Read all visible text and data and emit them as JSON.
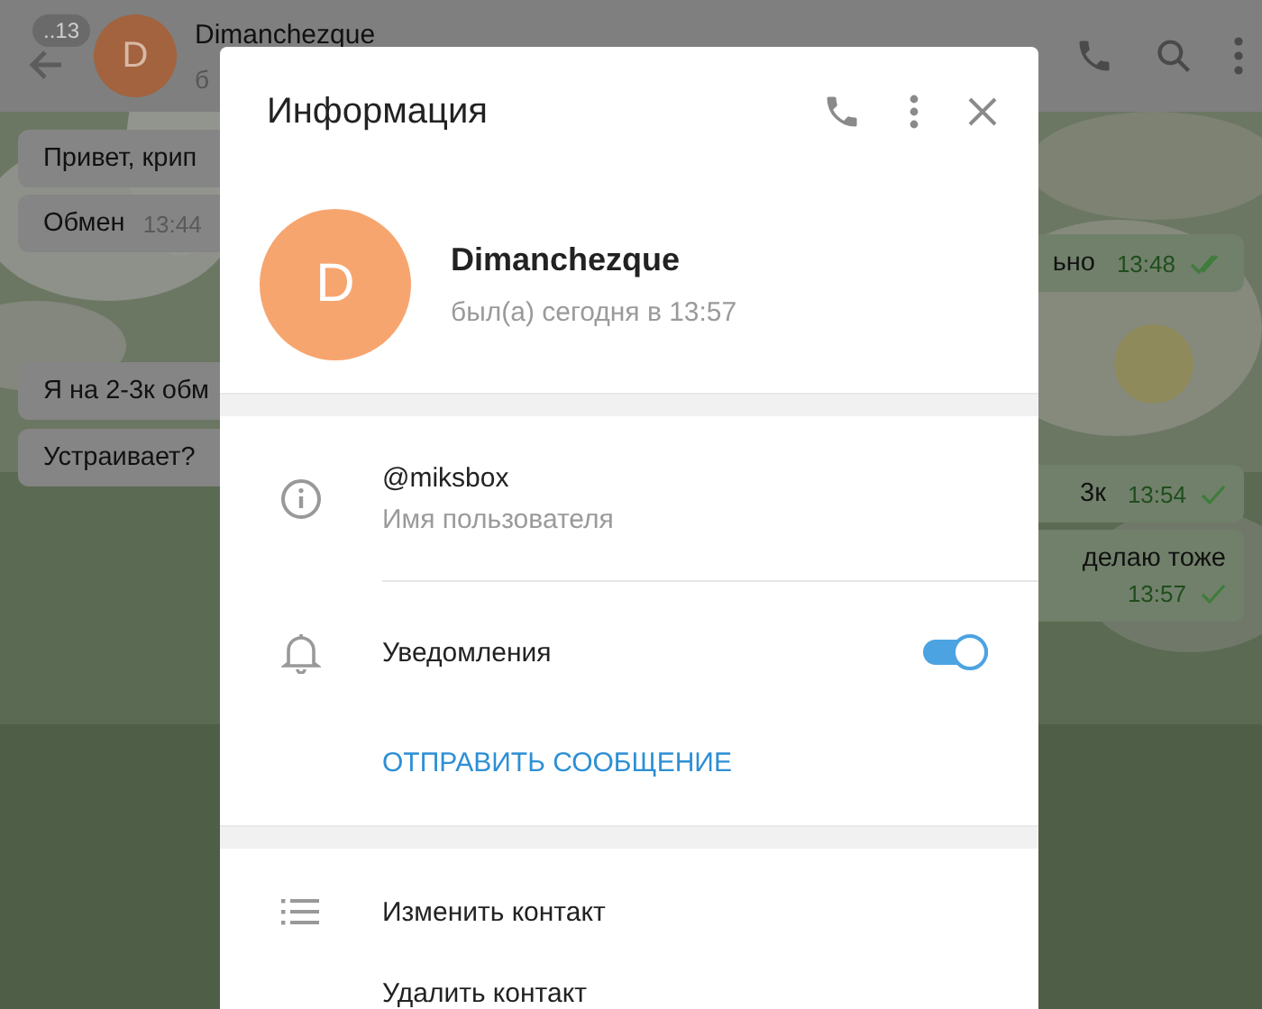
{
  "chat_header": {
    "badge": "..13",
    "avatar_letter": "D",
    "name": "Dimanchezque",
    "status": "б"
  },
  "messages_left": [
    {
      "text": "Привет, крип"
    },
    {
      "text": "Обмен",
      "time": "13:44"
    },
    {
      "text": "Я на 2-3к обм"
    },
    {
      "text": "Устраивает?"
    }
  ],
  "messages_right": [
    {
      "text": "ьно",
      "time": "13:48",
      "read": true
    },
    {
      "text": "3к",
      "time": "13:54",
      "read": false
    },
    {
      "text": "делаю тоже",
      "time": "13:57",
      "read": false
    }
  ],
  "dialog": {
    "title": "Информация",
    "avatar_letter": "D",
    "name": "Dimanchezque",
    "last_seen": "был(а) сегодня в 13:57",
    "username": "@miksbox",
    "username_label": "Имя пользователя",
    "notifications_label": "Уведомления",
    "notifications_on": true,
    "send_message": "ОТПРАВИТЬ СООБЩЕНИЕ",
    "actions": [
      "Изменить контакт",
      "Удалить контакт"
    ]
  }
}
